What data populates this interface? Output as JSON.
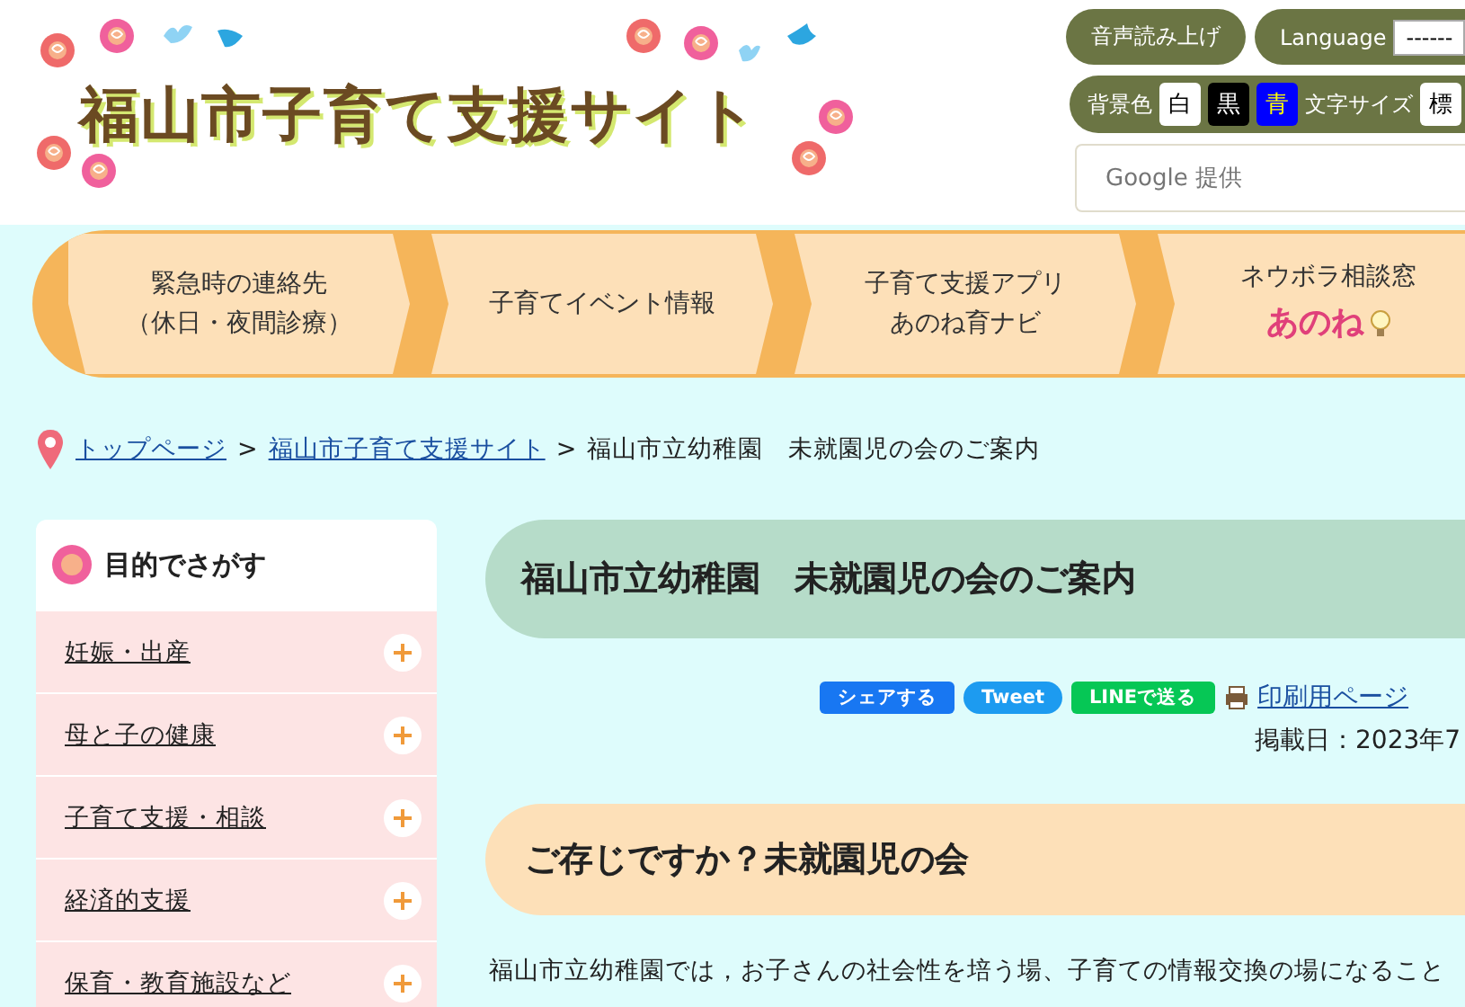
{
  "header": {
    "site_title": "福山市子育て支援サイト"
  },
  "tools": {
    "read_aloud": "音声読み上げ",
    "language_label": "Language",
    "language_value": "------",
    "bg_label": "背景色",
    "bg_options": [
      {
        "label": "白",
        "kind": "white"
      },
      {
        "label": "黒",
        "kind": "black"
      },
      {
        "label": "青",
        "kind": "blue"
      }
    ],
    "font_label": "文字サイズ",
    "font_option": "標",
    "search": {
      "placeholder": "Google 提供"
    }
  },
  "nav": [
    {
      "lines": [
        "緊急時の連絡先",
        "（休日・夜間診療）"
      ]
    },
    {
      "lines": [
        "子育てイベント情報"
      ]
    },
    {
      "lines": [
        "子育て支援アプリ",
        "あのね育ナビ"
      ]
    },
    {
      "lines": [
        "ネウボラ相談窓"
      ],
      "logo": "あのね"
    }
  ],
  "breadcrumb": [
    {
      "label": "トップページ",
      "link": true
    },
    {
      "label": "福山市子育て支援サイト",
      "link": true,
      "separator": ">"
    },
    {
      "label": "福山市立幼稚園　未就園児の会のご案内",
      "link": false,
      "separator": ">"
    }
  ],
  "sidebar": {
    "heading": "目的でさがす",
    "items": [
      "妊娠・出産",
      "母と子の健康",
      "子育て支援・相談",
      "経済的支援",
      "保育・教育施設など"
    ]
  },
  "main": {
    "title": "福山市立幼稚園　未就園児の会のご案内",
    "share": [
      {
        "label": "シェアする",
        "kind": "facebook"
      },
      {
        "label": "Tweet",
        "kind": "twitter"
      },
      {
        "label": "LINEで送る",
        "kind": "line"
      }
    ],
    "print_link": "印刷用ページ",
    "date": "掲載日：2023年7",
    "section_heading": "ご存じですか？未就園児の会",
    "paragraph": "福山市立幼稚園では，お子さんの社会性を培う場、子育ての情報交換の場になること"
  }
}
